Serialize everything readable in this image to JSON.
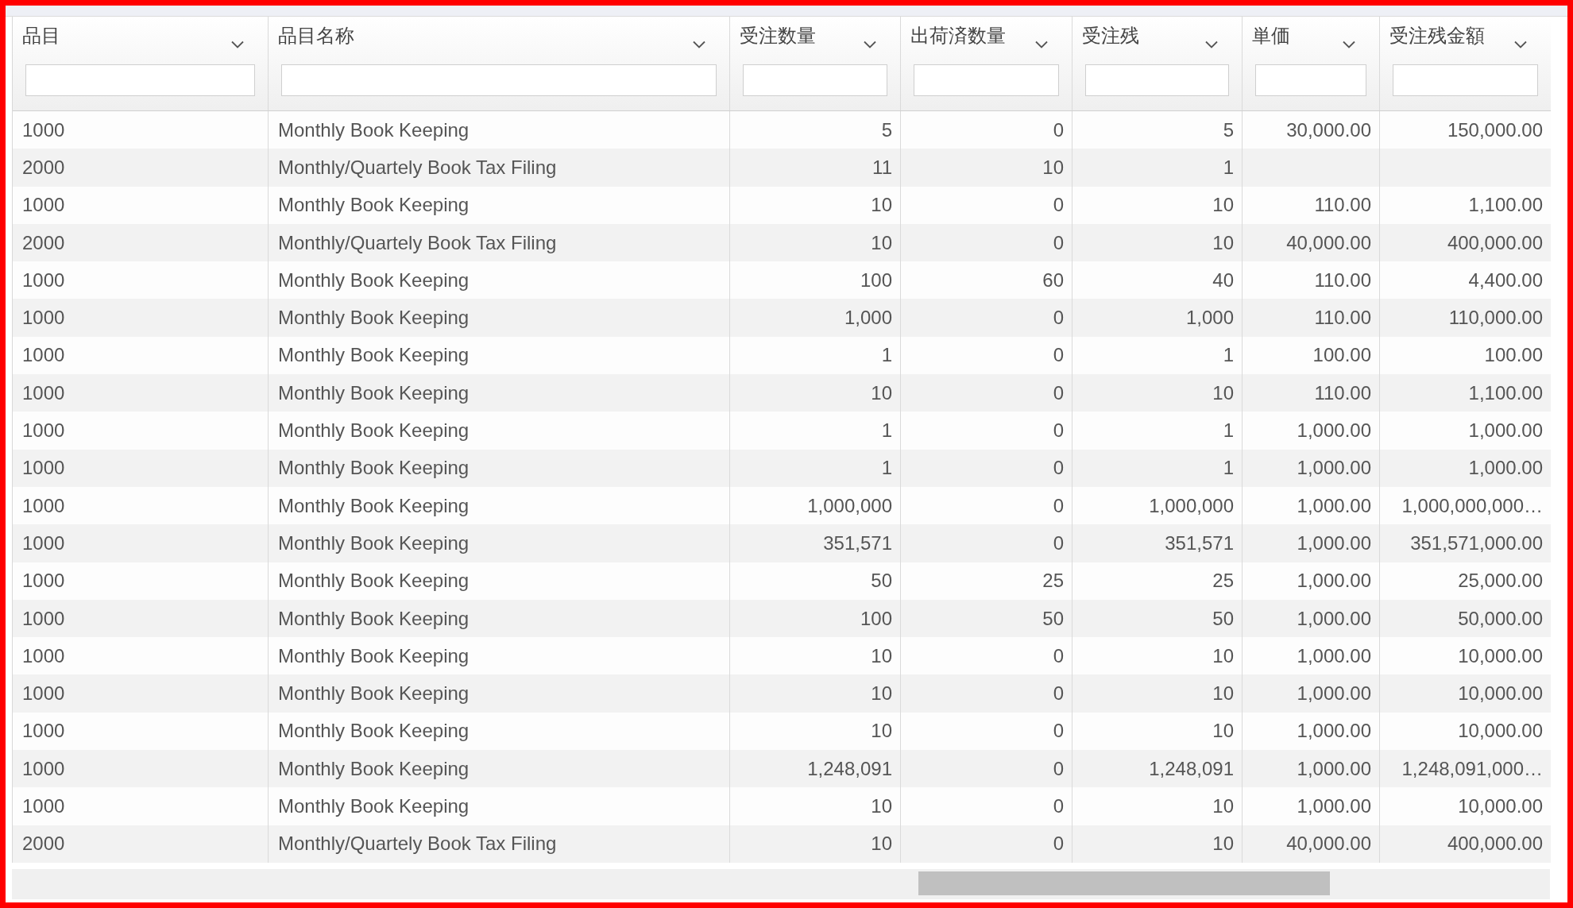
{
  "table": {
    "columns": [
      {
        "label": "品目",
        "kind": "text"
      },
      {
        "label": "品目名称",
        "kind": "text"
      },
      {
        "label": "受注数量",
        "kind": "number"
      },
      {
        "label": "出荷済数量",
        "kind": "number"
      },
      {
        "label": "受注残",
        "kind": "number"
      },
      {
        "label": "単価",
        "kind": "number"
      },
      {
        "label": "受注残金額",
        "kind": "number"
      }
    ],
    "rows": [
      [
        "1000",
        "Monthly Book Keeping",
        "5",
        "0",
        "5",
        "30,000.00",
        "150,000.00"
      ],
      [
        "2000",
        "Monthly/Quartely Book Tax Filing",
        "11",
        "10",
        "1",
        null,
        null
      ],
      [
        "1000",
        "Monthly Book Keeping",
        "10",
        "0",
        "10",
        "110.00",
        "1,100.00"
      ],
      [
        "2000",
        "Monthly/Quartely Book Tax Filing",
        "10",
        "0",
        "10",
        "40,000.00",
        "400,000.00"
      ],
      [
        "1000",
        "Monthly Book Keeping",
        "100",
        "60",
        "40",
        "110.00",
        "4,400.00"
      ],
      [
        "1000",
        "Monthly Book Keeping",
        "1,000",
        "0",
        "1,000",
        "110.00",
        "110,000.00"
      ],
      [
        "1000",
        "Monthly Book Keeping",
        "1",
        "0",
        "1",
        "100.00",
        "100.00"
      ],
      [
        "1000",
        "Monthly Book Keeping",
        "10",
        "0",
        "10",
        "110.00",
        "1,100.00"
      ],
      [
        "1000",
        "Monthly Book Keeping",
        "1",
        "0",
        "1",
        "1,000.00",
        "1,000.00"
      ],
      [
        "1000",
        "Monthly Book Keeping",
        "1",
        "0",
        "1",
        "1,000.00",
        "1,000.00"
      ],
      [
        "1000",
        "Monthly Book Keeping",
        "1,000,000",
        "0",
        "1,000,000",
        "1,000.00",
        "1,000,000,000…"
      ],
      [
        "1000",
        "Monthly Book Keeping",
        "351,571",
        "0",
        "351,571",
        "1,000.00",
        "351,571,000.00"
      ],
      [
        "1000",
        "Monthly Book Keeping",
        "50",
        "25",
        "25",
        "1,000.00",
        "25,000.00"
      ],
      [
        "1000",
        "Monthly Book Keeping",
        "100",
        "50",
        "50",
        "1,000.00",
        "50,000.00"
      ],
      [
        "1000",
        "Monthly Book Keeping",
        "10",
        "0",
        "10",
        "1,000.00",
        "10,000.00"
      ],
      [
        "1000",
        "Monthly Book Keeping",
        "10",
        "0",
        "10",
        "1,000.00",
        "10,000.00"
      ],
      [
        "1000",
        "Monthly Book Keeping",
        "10",
        "0",
        "10",
        "1,000.00",
        "10,000.00"
      ],
      [
        "1000",
        "Monthly Book Keeping",
        "1,248,091",
        "0",
        "1,248,091",
        "1,000.00",
        "1,248,091,000…"
      ],
      [
        "1000",
        "Monthly Book Keeping",
        "10",
        "0",
        "10",
        "1,000.00",
        "10,000.00"
      ],
      [
        "2000",
        "Monthly/Quartely Book Tax Filing",
        "10",
        "0",
        "10",
        "40,000.00",
        "400,000.00"
      ]
    ]
  }
}
